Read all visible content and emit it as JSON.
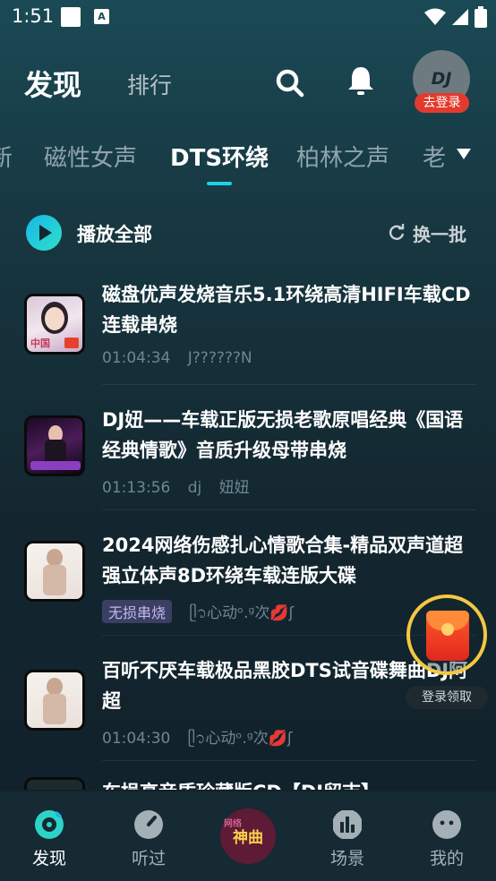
{
  "status_bar": {
    "time": "1:51"
  },
  "header": {
    "tab_discover": "发现",
    "tab_rank": "排行",
    "avatar_text": "DJ",
    "login_badge": "去登录"
  },
  "categories": {
    "items": [
      "新",
      "磁性女声",
      "DTS环绕",
      "柏林之声",
      "老"
    ],
    "active_index": 2
  },
  "playall": {
    "label": "播放全部",
    "refresh_label": "换一批"
  },
  "songs": [
    {
      "title": "磁盘优声发烧音乐5.1环绕高清HIFI车载CD连载串烧",
      "duration": "01:04:34",
      "author": "J??????N",
      "tag": "",
      "listeners": "",
      "thumb_text": "中国"
    },
    {
      "title": "DJ妞——车载正版无损老歌原唱经典《国语经典情歌》音质升级母带串烧",
      "duration": "01:13:56",
      "author": "dj",
      "tag": "",
      "listeners": "妞妞",
      "thumb_text": ""
    },
    {
      "title": "2024网络伤感扎心情歌合集-精品双声道超强立体声8D环绕车载连版大碟",
      "duration": "",
      "author": "",
      "tag": "无损串烧",
      "listeners": "ᥫ᭡心动ᵒ.ᵍ次💋ʃ",
      "thumb_text": ""
    },
    {
      "title": " 百听不厌车载极品黑胶DTS试音碟舞曲DJ阿超",
      "duration": "01:04:30",
      "author": "",
      "tag": "",
      "listeners": "ᥫ᭡心动ᵒ.ᵍ次💋ʃ",
      "thumb_text": ""
    },
    {
      "title": "车损高音质珍藏版CD【DJ留吉】",
      "duration": "",
      "author": "",
      "tag": "",
      "listeners": "",
      "thumb_text": ""
    }
  ],
  "redpacket": {
    "label": "登录领取"
  },
  "bottom_nav": {
    "items": [
      {
        "label": "发现",
        "icon": "discover-icon"
      },
      {
        "label": "听过",
        "icon": "history-icon"
      },
      {
        "label": "场景",
        "icon": "scene-icon"
      },
      {
        "label": "我的",
        "icon": "profile-icon"
      }
    ],
    "center_text": "神曲",
    "center_sub": "网络"
  },
  "colors": {
    "accent": "#19d2e6",
    "badge_red": "#e23b2e",
    "tag_bg": "#3b3f63",
    "meta_text": "#6e8790"
  }
}
